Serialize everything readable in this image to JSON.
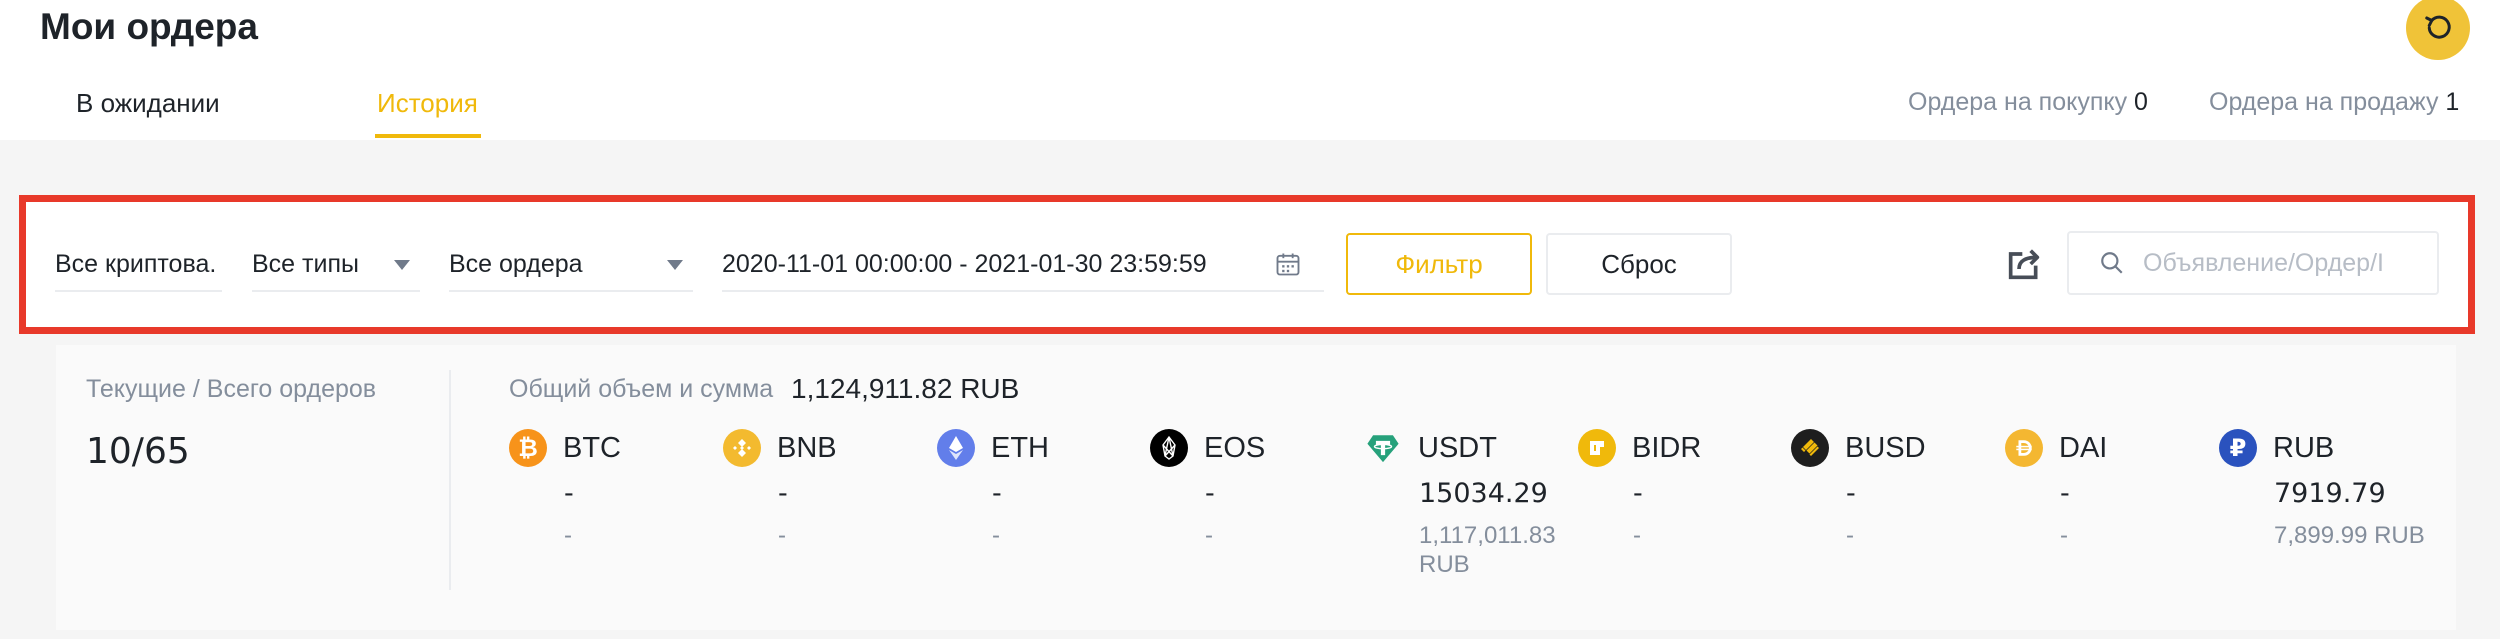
{
  "header": {
    "title": "Мои ордера",
    "tabs": [
      {
        "label": "В ожидании"
      },
      {
        "label": "История"
      }
    ],
    "buy_orders_label": "Ордера на покупку",
    "buy_orders_count": "0",
    "sell_orders_label": "Ордера на продажу",
    "sell_orders_count": "1"
  },
  "filters": {
    "crypto": "Все криптова.",
    "types": "Все типы",
    "orders": "Все ордера",
    "date_range": "2020-11-01 00:00:00 - 2021-01-30 23:59:59",
    "filter_button": "Фильтр",
    "reset_button": "Сброс",
    "search_placeholder": "Объявление/Ордер/I"
  },
  "summary": {
    "current_total_label": "Текущие / Всего ордеров",
    "current_total_value": "10/65",
    "total_volume_label": "Общий объем и сумма",
    "total_volume_value": "1,124,911.82 RUB",
    "coins": [
      {
        "name": "BTC",
        "amount": "-",
        "rub": "-",
        "color": "#f7931a",
        "icon": "bitcoin-icon"
      },
      {
        "name": "BNB",
        "amount": "-",
        "rub": "-",
        "color": "#f3ba2f",
        "icon": "bnb-icon"
      },
      {
        "name": "ETH",
        "amount": "-",
        "rub": "-",
        "color": "#627eea",
        "icon": "ethereum-icon"
      },
      {
        "name": "EOS",
        "amount": "-",
        "rub": "-",
        "color": "#000000",
        "icon": "eos-icon"
      },
      {
        "name": "USDT",
        "amount": "15034.29",
        "rub": "1,117,011.83 RUB",
        "color": "#26a17b",
        "icon": "tether-icon"
      },
      {
        "name": "BIDR",
        "amount": "-",
        "rub": "-",
        "color": "#f0b90b",
        "icon": "bidr-icon"
      },
      {
        "name": "BUSD",
        "amount": "-",
        "rub": "-",
        "color": "#1e1e1e",
        "icon": "busd-icon"
      },
      {
        "name": "DAI",
        "amount": "-",
        "rub": "-",
        "color": "#f4b731",
        "icon": "dai-icon"
      },
      {
        "name": "RUB",
        "amount": "7919.79",
        "rub": "7,899.99 RUB",
        "color": "#2a52be",
        "icon": "ruble-icon"
      }
    ]
  },
  "colors": {
    "accent": "#f0b90b",
    "highlight_border": "#e8392a"
  }
}
